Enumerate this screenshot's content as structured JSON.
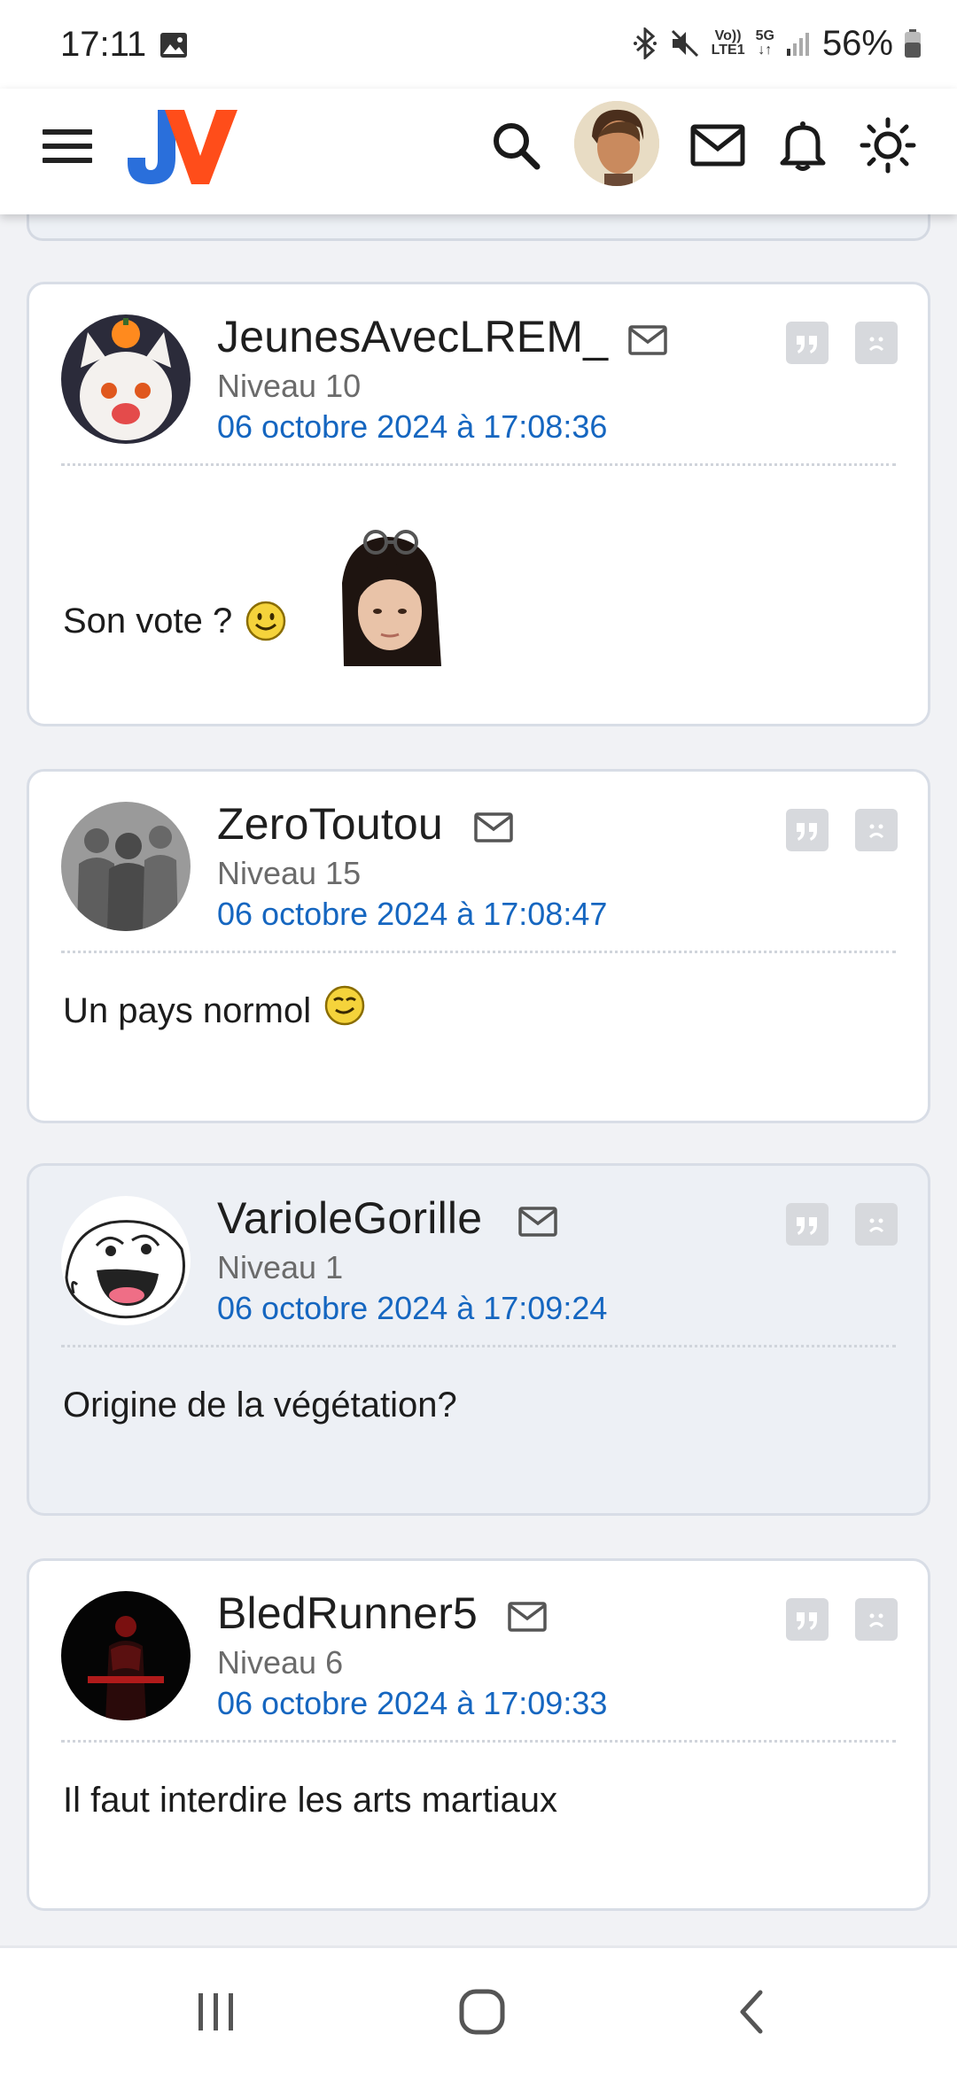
{
  "status_bar": {
    "time": "17:11",
    "network_top": "Vo))",
    "network_bottom": "LTE1",
    "network_gen": "5G",
    "battery": "56%",
    "icons": [
      "gallery-icon",
      "bluetooth-icon",
      "mute-icon",
      "signal-icon",
      "battery-icon"
    ]
  },
  "header": {
    "logo": "JV",
    "icons": [
      "menu-icon",
      "search-icon",
      "avatar",
      "mail-icon",
      "bell-icon",
      "brightness-icon"
    ]
  },
  "posts": [
    {
      "username": "JeunesAvecLREM_",
      "level": "Niveau 10",
      "date": "06 octobre 2024 à 17:08:36",
      "message": "Son vote ?",
      "emoji": "smile",
      "has_sticker": true,
      "highlight": false
    },
    {
      "username": "ZeroToutou",
      "level": "Niveau 15",
      "date": "06 octobre 2024 à 17:08:47",
      "message": "Un pays normol",
      "emoji": "grin",
      "has_sticker": false,
      "highlight": false
    },
    {
      "username": "VarioleGorille",
      "level": "Niveau 1",
      "date": "06 octobre 2024 à 17:09:24",
      "message": "Origine de la végétation?",
      "emoji": "",
      "has_sticker": false,
      "highlight": true
    },
    {
      "username": "BledRunner5",
      "level": "Niveau 6",
      "date": "06 octobre 2024 à 17:09:33",
      "message": "Il faut interdire les arts martiaux",
      "emoji": "",
      "has_sticker": false,
      "highlight": false
    }
  ],
  "colors": {
    "date_link": "#1566c0",
    "card_border": "#d8dde6",
    "highlight_bg": "#edf0f5",
    "logo_blue": "#2a6fdb",
    "logo_orange": "#ff4d1a"
  },
  "nav_bar": [
    "recent-apps-icon",
    "home-icon",
    "back-icon"
  ]
}
